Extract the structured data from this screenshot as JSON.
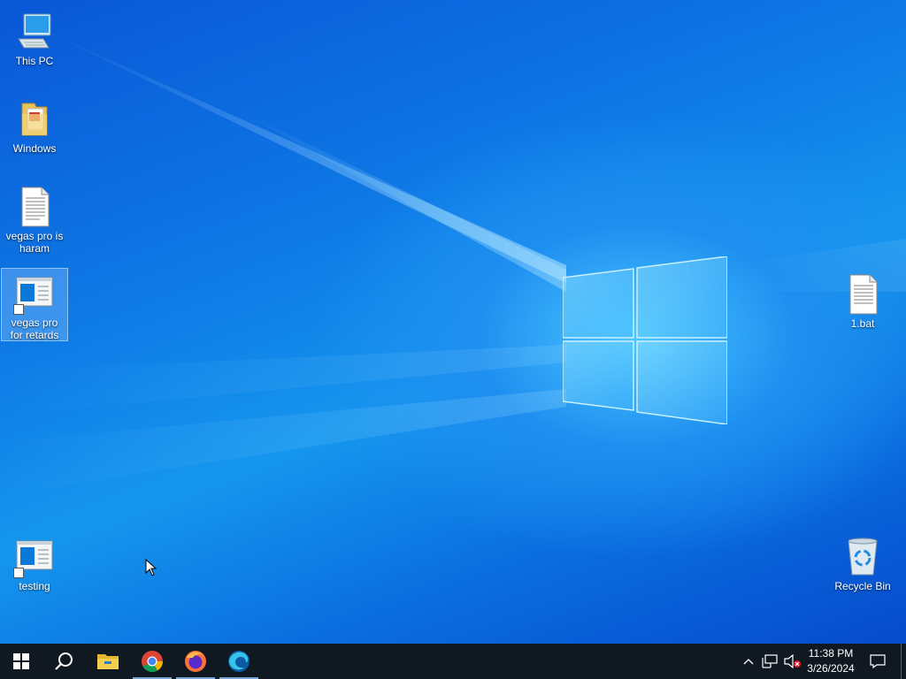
{
  "desktop": {
    "icons": [
      {
        "label": "This PC",
        "icon": "this-pc-icon"
      },
      {
        "label": "Windows",
        "icon": "folder-icon"
      },
      {
        "label": "vegas pro is haram",
        "icon": "text-file-icon"
      },
      {
        "label": "vegas pro for retards",
        "icon": "app-shortcut-icon"
      },
      {
        "label": "testing",
        "icon": "app-shortcut-icon"
      },
      {
        "label": "1.bat",
        "icon": "batch-file-icon"
      },
      {
        "label": "Recycle Bin",
        "icon": "recycle-bin-icon"
      }
    ]
  },
  "taskbar": {
    "pinned": [
      {
        "name": "start-button",
        "icon": "windows-start-icon"
      },
      {
        "name": "search-button",
        "icon": "search-icon"
      },
      {
        "name": "file-explorer",
        "icon": "file-explorer-icon"
      },
      {
        "name": "google-chrome",
        "icon": "chrome-icon"
      },
      {
        "name": "firefox",
        "icon": "firefox-icon"
      },
      {
        "name": "microsoft-edge",
        "icon": "edge-icon"
      }
    ],
    "tray": {
      "time": "11:38 PM",
      "date": "3/26/2024"
    }
  },
  "colors": {
    "taskbar": "#101822",
    "accent": "#0078d7",
    "selection": "#aad7ff"
  }
}
